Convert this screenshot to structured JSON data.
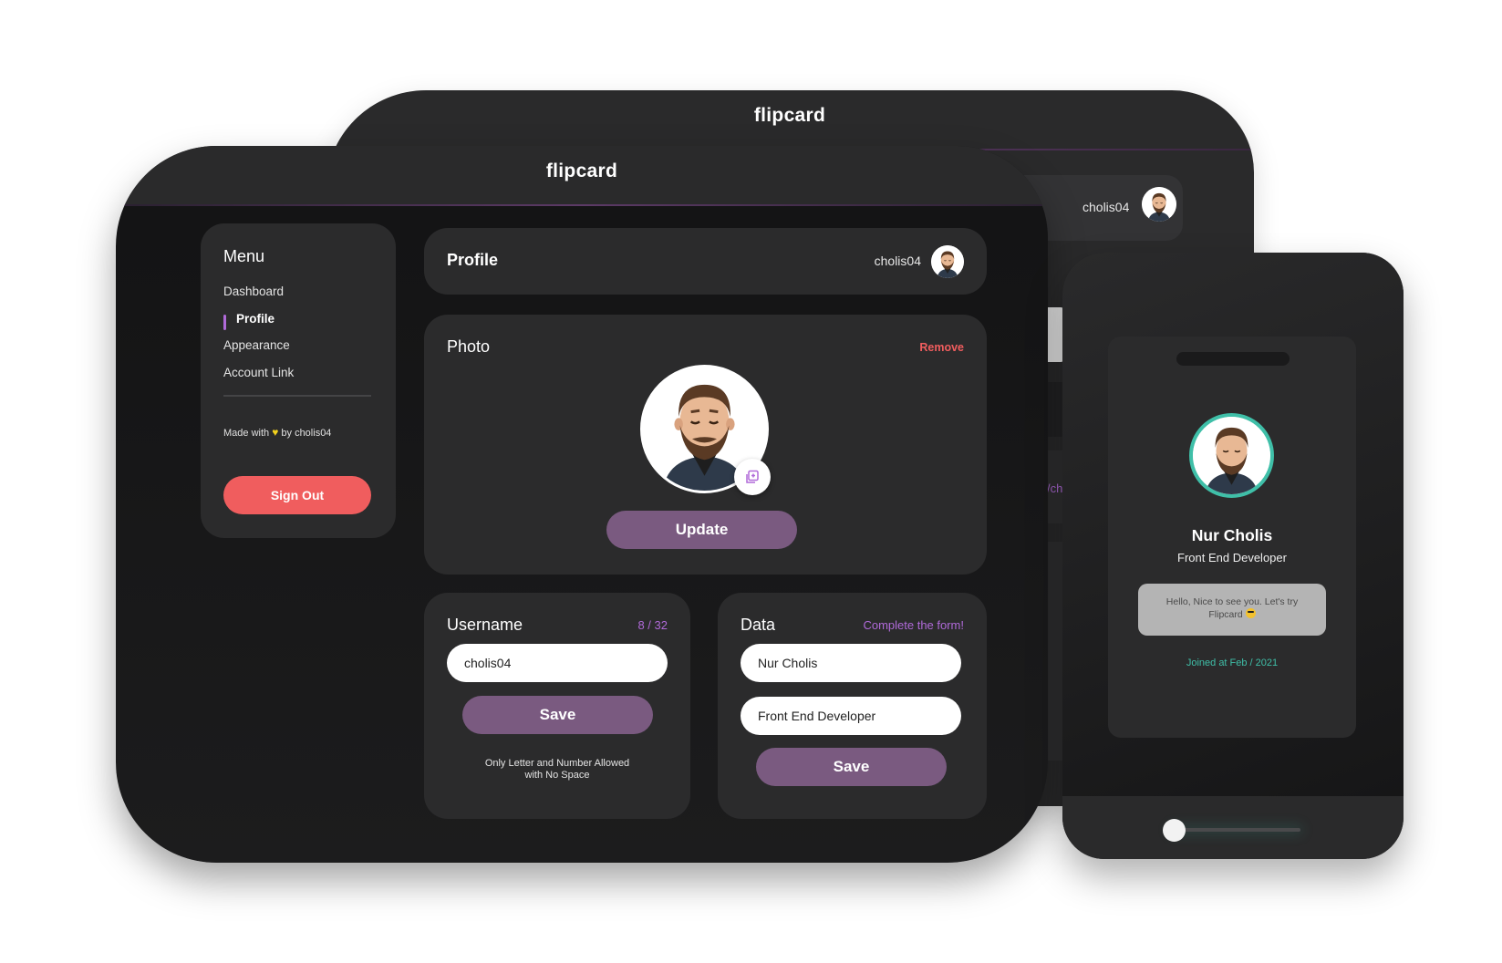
{
  "back_window": {
    "app_title": "flipcard",
    "username": "cholis04",
    "partial_text": "/chol"
  },
  "front_window": {
    "app_title": "flipcard",
    "sidebar": {
      "title": "Menu",
      "items": [
        {
          "label": "Dashboard",
          "active": false
        },
        {
          "label": "Profile",
          "active": true
        },
        {
          "label": "Appearance",
          "active": false
        },
        {
          "label": "Account Link",
          "active": false
        }
      ],
      "made_with_prefix": "Made with",
      "made_with_suffix": "by cholis04",
      "heart_icon": "heart-icon",
      "sign_out_label": "Sign Out"
    },
    "header": {
      "title": "Profile",
      "username": "cholis04"
    },
    "photo": {
      "title": "Photo",
      "remove_label": "Remove",
      "update_label": "Update",
      "edit_icon": "image-edit-icon"
    },
    "username_card": {
      "title": "Username",
      "counter": "8 / 32",
      "value": "cholis04",
      "save_label": "Save",
      "hint_line1": "Only Letter and Number Allowed",
      "hint_line2": "with No Space"
    },
    "data_card": {
      "title": "Data",
      "hint": "Complete the form!",
      "name_value": "Nur Cholis",
      "job_value": "Front End Developer",
      "save_label": "Save"
    }
  },
  "phone": {
    "name": "Nur Cholis",
    "role": "Front End Developer",
    "message": "Hello, Nice to see you. Let's try Flipcard",
    "message_emoji": "sunglasses-emoji",
    "joined": "Joined at Feb / 2021",
    "toggle_state": "off"
  },
  "colors": {
    "accent_purple": "#b06ad9",
    "button_purple": "#7a5a80",
    "danger_red": "#f05d5e",
    "teal": "#3fbfa8",
    "heart_yellow": "#f2d11d"
  }
}
